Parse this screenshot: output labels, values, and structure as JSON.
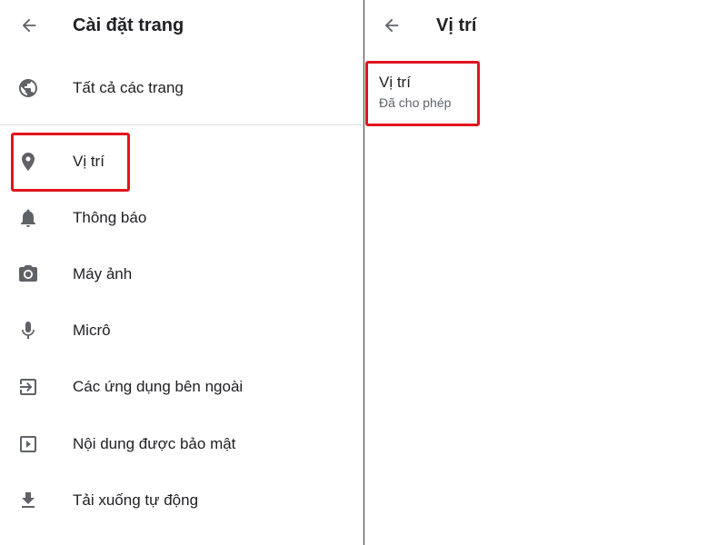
{
  "left_panel": {
    "title": "Cài đặt trang",
    "items": [
      {
        "label": "Tất cả các trang",
        "icon": "globe-icon"
      },
      {
        "label": "Vị trí",
        "icon": "location-pin-icon"
      },
      {
        "label": "Thông báo",
        "icon": "bell-icon"
      },
      {
        "label": "Máy ảnh",
        "icon": "camera-icon"
      },
      {
        "label": "Micrô",
        "icon": "microphone-icon"
      },
      {
        "label": "Các ứng dụng bên ngoài",
        "icon": "external-app-icon"
      },
      {
        "label": "Nội dung được bảo mật",
        "icon": "protected-content-icon"
      },
      {
        "label": "Tải xuống tự động",
        "icon": "download-icon"
      }
    ]
  },
  "right_panel": {
    "title": "Vị trí",
    "setting": {
      "title": "Vị trí",
      "status": "Đã cho phép"
    }
  },
  "colors": {
    "highlight": "#e0141e",
    "icon": "#5f6368",
    "text": "#202124",
    "secondary_text": "#5f6368"
  }
}
